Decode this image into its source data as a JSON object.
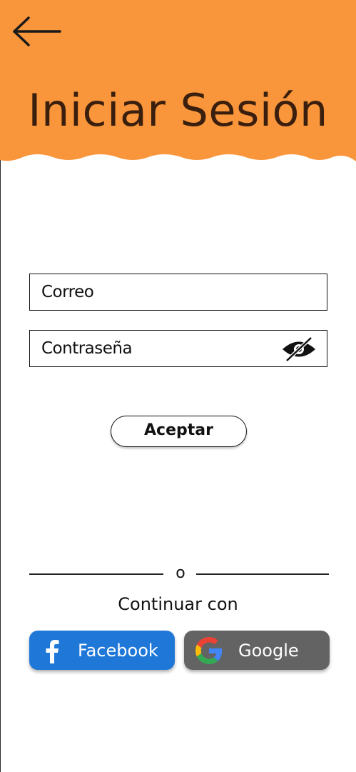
{
  "colors": {
    "header_bg": "#f9953a",
    "title": "#3a1f0e",
    "facebook": "#1f78d8",
    "google": "#636363"
  },
  "header": {
    "back_icon": "arrow-left-icon",
    "title": "Iniciar Sesión"
  },
  "form": {
    "email_placeholder": "Correo",
    "password_placeholder": "Contraseña",
    "password_toggle_icon": "eye-slash-icon",
    "submit_label": "Aceptar"
  },
  "divider": {
    "text": "o"
  },
  "social": {
    "prompt": "Continuar con",
    "facebook_label": "Facebook",
    "facebook_icon": "facebook-f-icon",
    "google_label": "Google",
    "google_icon": "google-g-icon"
  }
}
